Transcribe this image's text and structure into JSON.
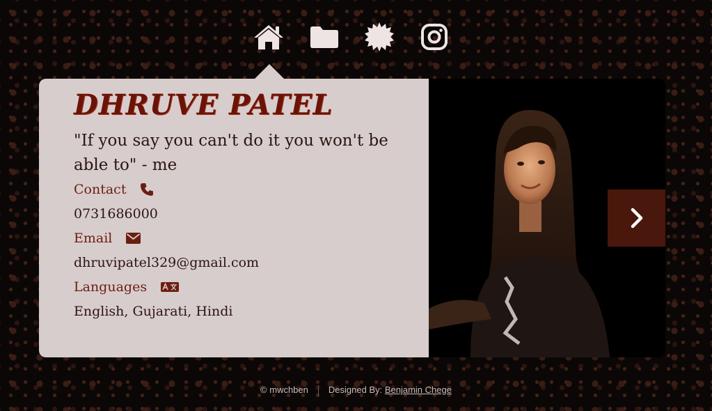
{
  "nav": {
    "items": [
      {
        "icon": "home-icon"
      },
      {
        "icon": "folder-icon"
      },
      {
        "icon": "badge-icon"
      },
      {
        "icon": "instagram-icon"
      }
    ]
  },
  "profile": {
    "name": "DHRUVE PATEL",
    "quote": "\"If you say you can't do it you won't be able to\" - me",
    "contact_label": "Contact",
    "contact_value": "0731686000",
    "email_label": "Email",
    "email_value": "dhruvipatel329@gmail.com",
    "languages_label": "Languages",
    "languages_value": "English, Gujarati, Hindi"
  },
  "slider": {
    "next_icon": "chevron-right-icon"
  },
  "footer": {
    "copyright": "© mwchben",
    "designed_by_label": "Designed By:",
    "designer_name": "Benjamin Chege"
  },
  "colors": {
    "accent": "#6b1307",
    "card_bg": "#d8cdcd",
    "next_button": "#4a170c",
    "icon": "#efe4e4"
  }
}
